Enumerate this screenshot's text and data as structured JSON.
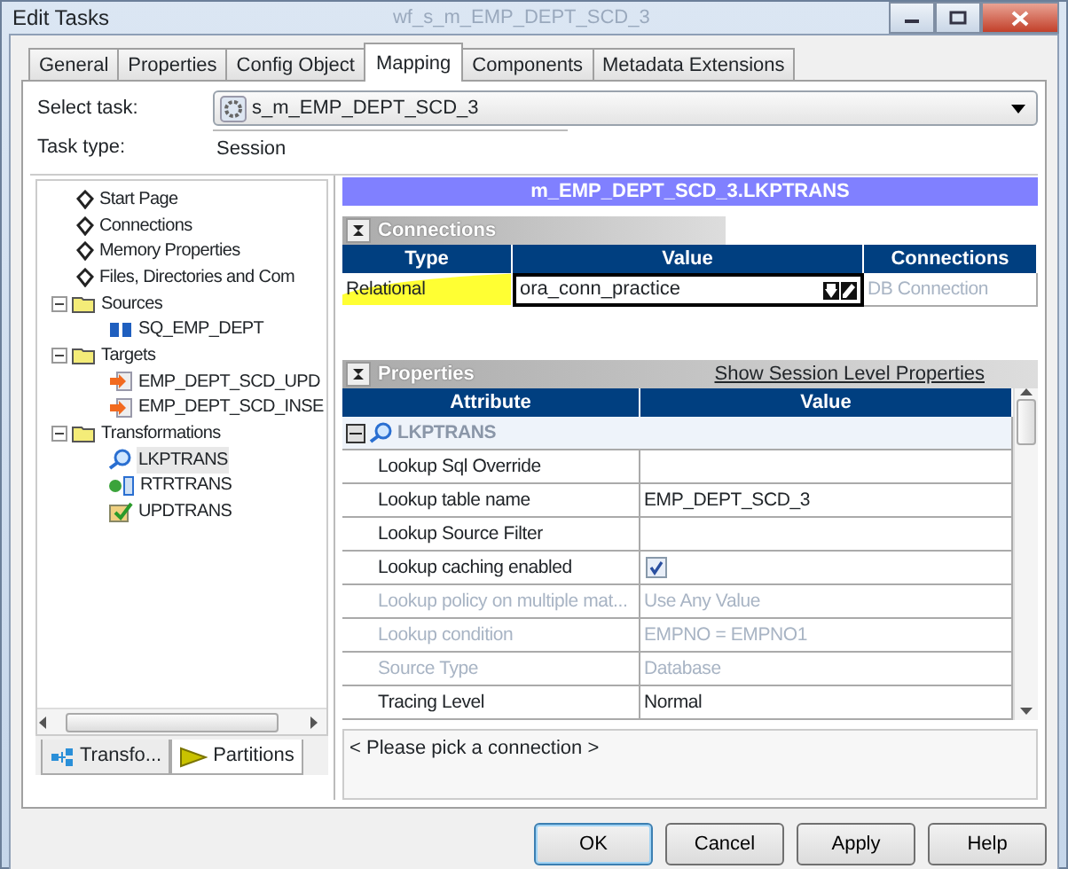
{
  "window": {
    "title": "Edit Tasks",
    "background_title": "wf_s_m_EMP_DEPT_SCD_3"
  },
  "tabs": [
    {
      "label": "General",
      "selected": false
    },
    {
      "label": "Properties",
      "selected": false
    },
    {
      "label": "Config Object",
      "selected": false
    },
    {
      "label": "Mapping",
      "selected": true
    },
    {
      "label": "Components",
      "selected": false
    },
    {
      "label": "Metadata Extensions",
      "selected": false
    }
  ],
  "select_task": {
    "label": "Select task:",
    "value": "s_m_EMP_DEPT_SCD_3"
  },
  "task_type": {
    "label": "Task type:",
    "value": "Session"
  },
  "tree": [
    {
      "label": "Start Page",
      "kind": "page",
      "selected": false
    },
    {
      "label": "Connections",
      "kind": "page",
      "selected": false
    },
    {
      "label": "Memory Properties",
      "kind": "page",
      "selected": false
    },
    {
      "label": "Files, Directories and Com",
      "kind": "page",
      "selected": false
    },
    {
      "label": "Sources",
      "kind": "folder",
      "expanded": true,
      "selected": false,
      "children": [
        {
          "label": "SQ_EMP_DEPT",
          "kind": "source",
          "selected": false
        }
      ]
    },
    {
      "label": "Targets",
      "kind": "folder",
      "expanded": true,
      "selected": false,
      "children": [
        {
          "label": "EMP_DEPT_SCD_UPD",
          "kind": "target",
          "selected": false
        },
        {
          "label": "EMP_DEPT_SCD_INSE",
          "kind": "target",
          "selected": false
        }
      ]
    },
    {
      "label": "Transformations",
      "kind": "folder",
      "expanded": true,
      "selected": false,
      "children": [
        {
          "label": "LKPTRANS",
          "kind": "lookup",
          "selected": true
        },
        {
          "label": "RTRTRANS",
          "kind": "router",
          "selected": false
        },
        {
          "label": "UPDTRANS",
          "kind": "update",
          "selected": false
        }
      ]
    }
  ],
  "bottom_tabs": [
    {
      "label": "Transfo...",
      "kind": "network",
      "selected": false
    },
    {
      "label": "Partitions",
      "kind": "flag",
      "selected": true
    }
  ],
  "panel_title": "m_EMP_DEPT_SCD_3.LKPTRANS",
  "connections": {
    "title": "Connections",
    "columns": [
      "Type",
      "Value",
      "Connections"
    ],
    "rows": [
      {
        "type": "Relational",
        "value": "ora_conn_practice",
        "connections": "DB Connection",
        "highlighted": true
      }
    ]
  },
  "properties": {
    "title": "Properties",
    "link": "Show Session Level Properties",
    "columns": [
      "Attribute",
      "Value"
    ],
    "group": "LKPTRANS",
    "rows": [
      {
        "attribute": "Lookup Sql Override",
        "kind": "text",
        "value": "",
        "disabled": false
      },
      {
        "attribute": "Lookup table name",
        "kind": "text",
        "value": "EMP_DEPT_SCD_3",
        "disabled": false
      },
      {
        "attribute": "Lookup Source Filter",
        "kind": "text",
        "value": "",
        "disabled": false
      },
      {
        "attribute": "Lookup caching enabled",
        "kind": "checkbox",
        "checked": true,
        "disabled": false
      },
      {
        "attribute": "Lookup policy on multiple mat...",
        "kind": "text",
        "value": "Use Any Value",
        "disabled": true
      },
      {
        "attribute": "Lookup condition",
        "kind": "text",
        "value": "EMPNO = EMPNO1",
        "disabled": true
      },
      {
        "attribute": "Source Type",
        "kind": "text",
        "value": "Database",
        "disabled": true
      },
      {
        "attribute": "Tracing Level",
        "kind": "text",
        "value": "Normal",
        "disabled": false
      }
    ]
  },
  "message": "< Please pick a connection >",
  "buttons": [
    {
      "label": "OK",
      "default": true
    },
    {
      "label": "Cancel",
      "default": false
    },
    {
      "label": "Apply",
      "default": false
    },
    {
      "label": "Help",
      "default": false
    }
  ]
}
